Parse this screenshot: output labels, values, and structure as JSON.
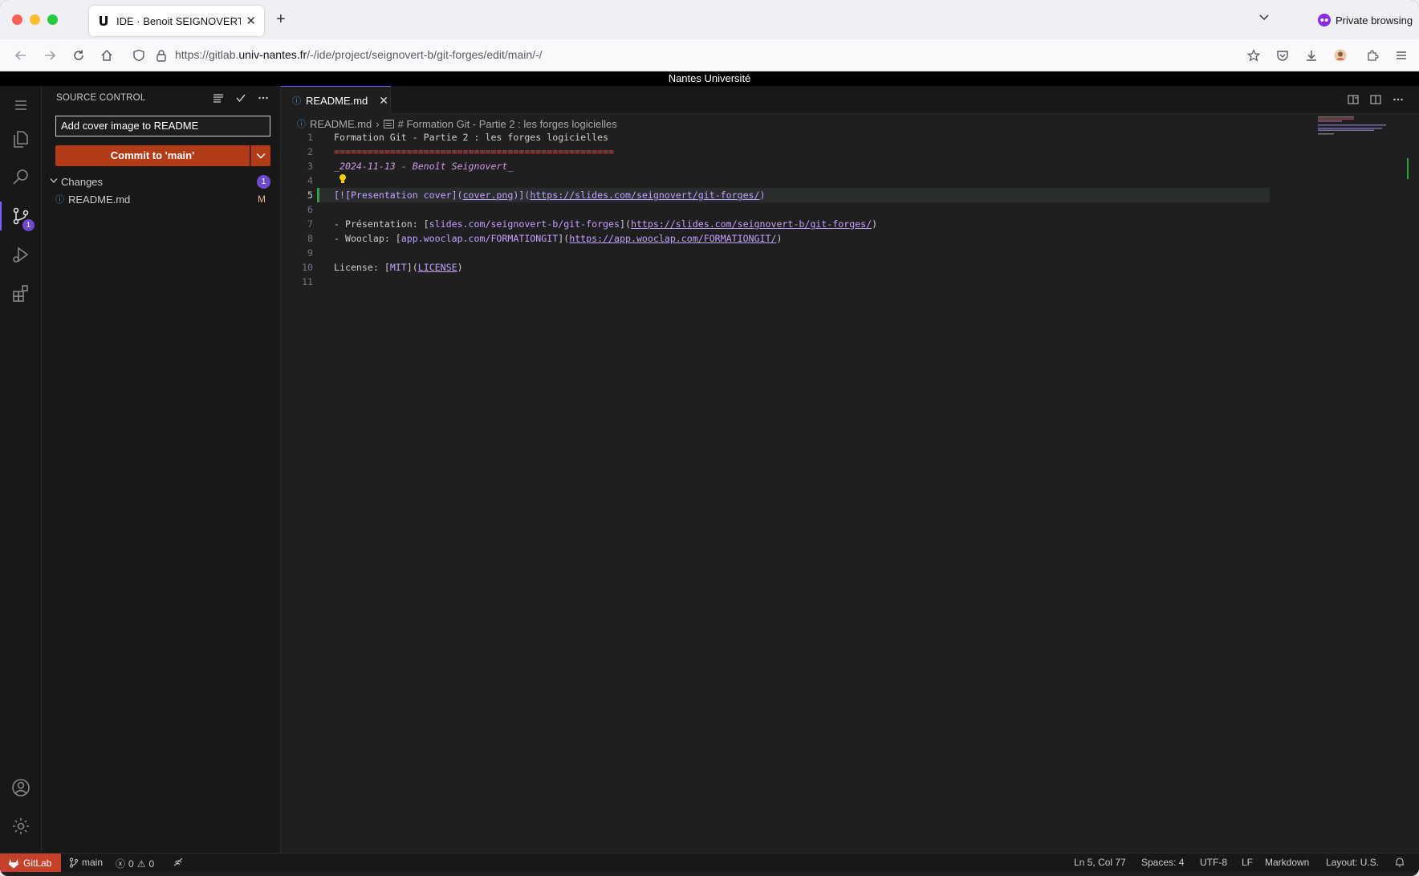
{
  "browser": {
    "tab_title": "IDE · Benoit SEIGNOVERT / Forr",
    "private_label": "Private browsing",
    "url_prefix": "https://gitlab.",
    "url_domain": "univ-nantes.fr",
    "url_path": "/-/ide/project/seignovert-b/git-forges/edit/main/-/"
  },
  "banner": {
    "text": "Nantes Université"
  },
  "activity_bar": {
    "items": [
      "files-icon",
      "search-icon",
      "source-control-icon",
      "run-debug-icon",
      "extensions-icon"
    ],
    "source_control_badge": "1",
    "bottom": [
      "account-icon",
      "settings-icon"
    ]
  },
  "sidebar": {
    "title": "SOURCE CONTROL",
    "commit_message": "Add cover image to README",
    "commit_button": "Commit to 'main'",
    "changes_label": "Changes",
    "changes_count": "1",
    "files": [
      {
        "name": "README.md",
        "status": "M"
      }
    ]
  },
  "editor": {
    "tab_label": "README.md",
    "breadcrumb_file": "README.md",
    "breadcrumb_symbol": "# Formation Git - Partie 2 : les forges logicielles",
    "line_numbers": [
      "1",
      "2",
      "3",
      "4",
      "5",
      "6",
      "7",
      "8",
      "9",
      "10",
      "11"
    ],
    "lines": {
      "l1": "Formation Git - Partie 2 : les forges logicielles",
      "l2": "==================================================",
      "l3": "_2024-11-13 - Benoît Seignovert_",
      "l5_a": "[![Presentation cover](",
      "l5_b": "cover.png",
      "l5_c": ")](",
      "l5_d": "https://slides.com/seignovert/git-forges/",
      "l5_e": ")",
      "l7_a": "- Présentation: [",
      "l7_b": "slides.com/seignovert-b/git-forges",
      "l7_c": "](",
      "l7_d": "https://slides.com/seignovert-b/git-forges/",
      "l7_e": ")",
      "l8_a": "- Wooclap: [",
      "l8_b": "app.wooclap.com/FORMATIONGIT",
      "l8_c": "](",
      "l8_d": "https://app.wooclap.com/FORMATIONGIT/",
      "l8_e": ")",
      "l10_a": "License: [",
      "l10_b": "MIT",
      "l10_c": "](",
      "l10_d": "LICENSE",
      "l10_e": ")"
    }
  },
  "status_bar": {
    "gitlab": "GitLab",
    "branch": "main",
    "errors": "0",
    "warnings": "0",
    "position": "Ln 5, Col 77",
    "spaces": "Spaces: 4",
    "encoding": "UTF-8",
    "eol": "LF",
    "language": "Markdown",
    "layout": "Layout: U.S."
  },
  "colors": {
    "accent": "#7b61ff",
    "commit_button": "#b23c17",
    "gitlab_status": "#c4422b",
    "modified_line": "#2ea043"
  }
}
